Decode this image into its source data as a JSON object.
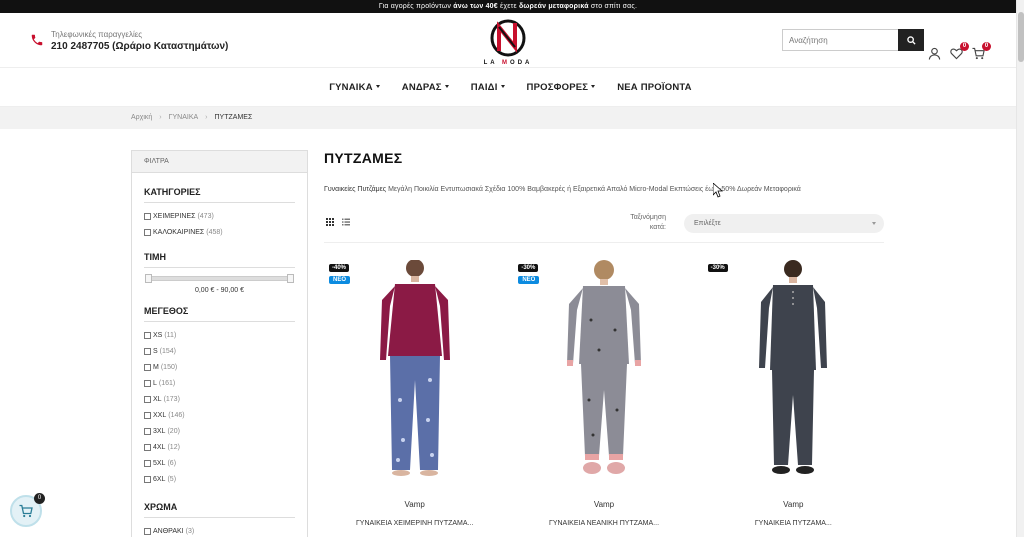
{
  "promo": {
    "part1": "Για αγορές προϊόντων ",
    "bold1": "άνω των 40€",
    "part2": " έχετε ",
    "bold2": "δωρεάν μεταφορικά",
    "part3": " στο σπίτι σας."
  },
  "header": {
    "phone_label": "Τηλεφωνικές παραγγελίες",
    "phone_number": "210 2487705 (Ωράριο Καταστημάτων)",
    "logo_text_1": "LA ",
    "logo_text_2": "M",
    "logo_text_3": "ODA",
    "search_placeholder": "Αναζήτηση",
    "wishlist_count": "0",
    "cart_count": "0"
  },
  "nav": {
    "items": [
      {
        "label": "ΓΥΝΑΙΚΑ"
      },
      {
        "label": "ΑΝΔΡΑΣ"
      },
      {
        "label": "ΠΑΙΔΙ"
      },
      {
        "label": "ΠΡΟΣΦΟΡΕΣ"
      },
      {
        "label": "ΝΕΑ ΠΡΟΪΟΝΤΑ"
      }
    ]
  },
  "breadcrumb": {
    "home": "Αρχική",
    "category": "ΓΥΝΑΙΚΑ",
    "current": "ΠΥΤΖΑΜΕΣ"
  },
  "filters": {
    "header": "ΦΙΛΤΡΑ",
    "categories_title": "ΚΑΤΗΓΟΡΙΕΣ",
    "categories": [
      {
        "label": "ΧΕΙΜΕΡΙΝΕΣ",
        "count": "(473)"
      },
      {
        "label": "ΚΑΛΟΚΑΙΡΙΝΕΣ",
        "count": "(458)"
      }
    ],
    "price_title": "ΤΙΜΗ",
    "price_range": "0,00 € - 90,00 €",
    "size_title": "ΜΕΓΕΘΟΣ",
    "sizes": [
      {
        "label": "XS",
        "count": "(11)"
      },
      {
        "label": "S",
        "count": "(154)"
      },
      {
        "label": "M",
        "count": "(150)"
      },
      {
        "label": "L",
        "count": "(161)"
      },
      {
        "label": "XL",
        "count": "(173)"
      },
      {
        "label": "XXL",
        "count": "(146)"
      },
      {
        "label": "3XL",
        "count": "(20)"
      },
      {
        "label": "4XL",
        "count": "(12)"
      },
      {
        "label": "5XL",
        "count": "(6)"
      },
      {
        "label": "6XL",
        "count": "(5)"
      }
    ],
    "color_title": "ΧΡΩΜΑ",
    "colors": [
      {
        "label": "ΑΝΘΡΑΚΙ",
        "count": "(3)"
      }
    ]
  },
  "main": {
    "title": "ΠΥΤΖΑΜΕΣ",
    "desc_bold": "Γυναικείες Πυτζάμες",
    "desc_rest": " Μεγάλη Ποικιλία Εντυπωσιακά Σχέδια 100% Βαμβακερές ή Εξαιρετικά Απαλό Micro-Modal Εκπτώσεις έως -50% Δωρεάν Μεταφορικά",
    "sort_label": "Ταξινόμηση κατά:",
    "sort_value": "Επιλέξτε"
  },
  "products": [
    {
      "discount": "-40%",
      "new": "ΝΕΟ",
      "brand": "Vamp",
      "name": "ΓΥΝΑΙΚΕΙΑ ΧΕΙΜΕΡΙΝΗ ΠΥΤΖΑΜΑ...",
      "top_color": "#8b1a45",
      "bottom_color": "#5b6fa8"
    },
    {
      "discount": "-30%",
      "new": "ΝΕΟ",
      "brand": "Vamp",
      "name": "ΓΥΝΑΙΚΕΙΑ ΝΕΑΝΙΚΗ ΠΥΤΖΑΜΑ...",
      "top_color": "#8c8c96",
      "bottom_color": "#8c8c96"
    },
    {
      "discount": "-30%",
      "brand": "Vamp",
      "name": "ΓΥΝΑΙΚΕΙΑ ΠΥΤΖΑΜΑ...",
      "top_color": "#3e434d",
      "bottom_color": "#3e434d"
    }
  ],
  "cart_widget_count": "0",
  "colors": {
    "accent": "#c8102e",
    "new_badge": "#0c8be0",
    "dark": "#111111"
  }
}
